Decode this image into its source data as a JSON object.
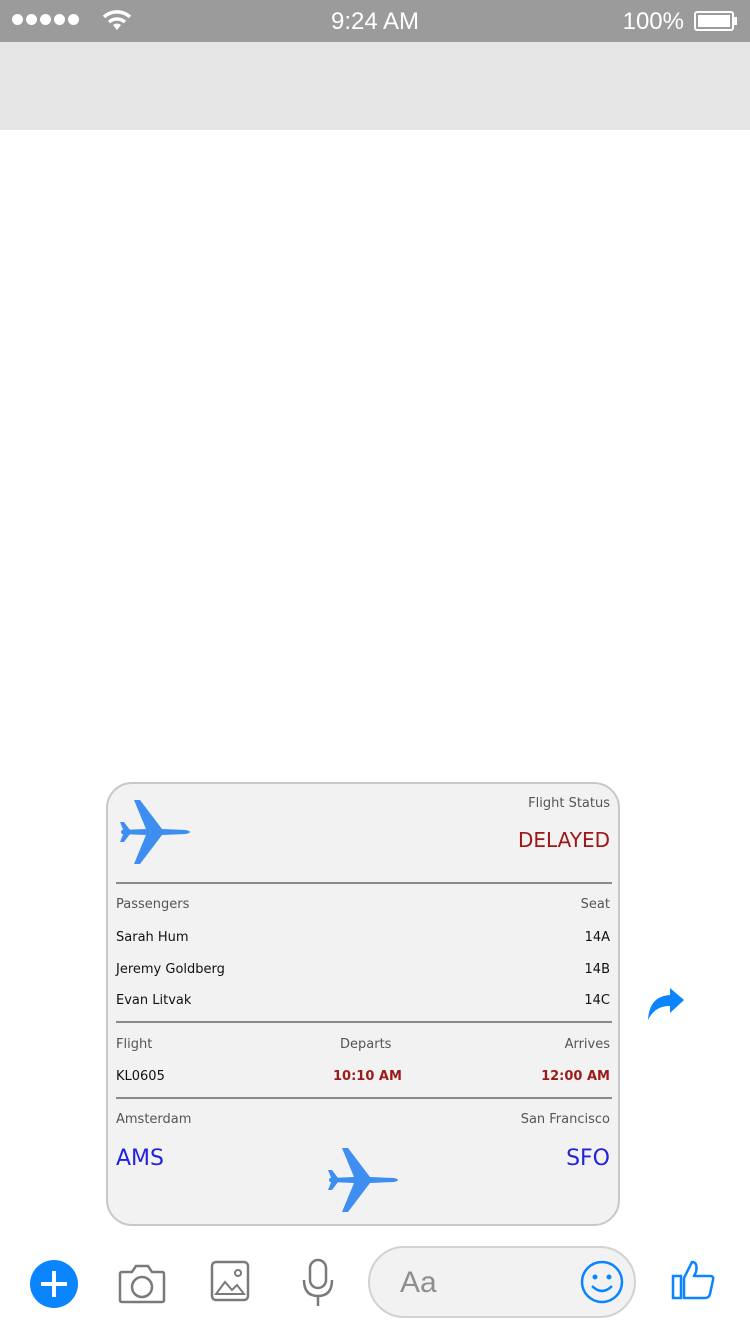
{
  "status_bar": {
    "time": "9:24 AM",
    "battery": "100%"
  },
  "flight_card": {
    "status_label": "Flight Status",
    "status_value": "DELAYED",
    "passengers_header": "Passengers",
    "seat_header": "Seat",
    "passengers": [
      {
        "name": "Sarah Hum",
        "seat": "14A"
      },
      {
        "name": "Jeremy Goldberg",
        "seat": "14B"
      },
      {
        "name": "Evan Litvak",
        "seat": "14C"
      }
    ],
    "flight_label": "Flight",
    "departs_label": "Departs",
    "arrives_label": "Arrives",
    "flight_number": "KL0605",
    "departs_time": "10:10 AM",
    "arrives_time": "12:00 AM",
    "origin_city": "Amsterdam",
    "destination_city": "San Francisco",
    "origin_code": "AMS",
    "destination_code": "SFO"
  },
  "composer": {
    "placeholder": "Aa"
  },
  "colors": {
    "accent": "#0a84ff",
    "delayed": "#a01515",
    "airport_code": "#2222dd",
    "plane": "#3d8ef0"
  },
  "icons": [
    "signal-dots",
    "wifi-icon",
    "battery-icon",
    "airplane-icon",
    "share-icon",
    "plus-icon",
    "camera-icon",
    "gallery-icon",
    "microphone-icon",
    "emoji-icon",
    "thumbs-up-icon"
  ]
}
